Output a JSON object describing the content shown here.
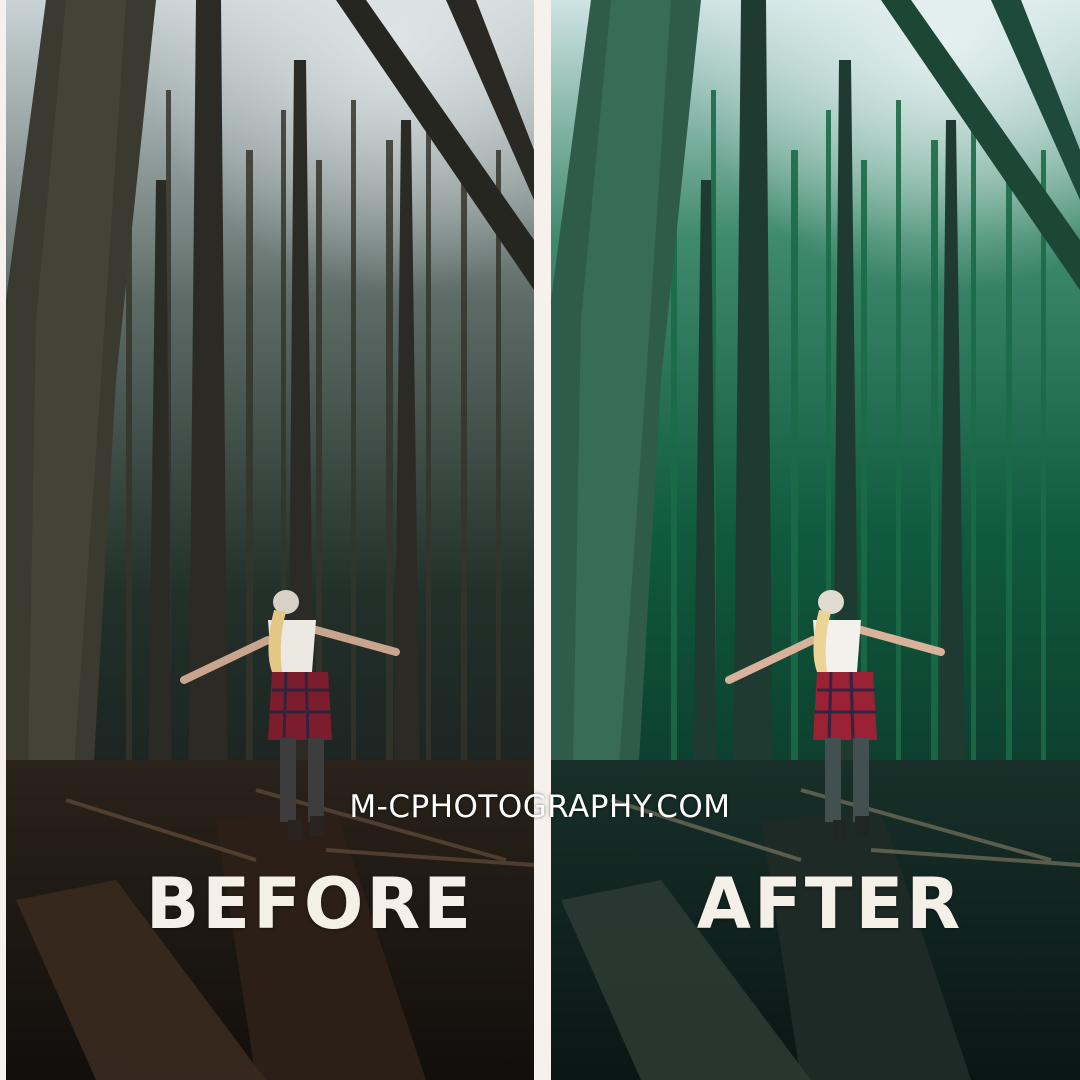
{
  "labels": {
    "before": "BEFORE",
    "after": "AFTER",
    "watermark": "M-CPHOTOGRAPHY.COM"
  },
  "colors": {
    "background": "#f6f1ec",
    "label_text": "#f4efe7",
    "before_sky": "#c9d3d6",
    "before_canopy": "#22302a",
    "before_trunk": "#2c2a24",
    "before_floor": "#1d1712",
    "after_sky": "#cfe3e4",
    "after_canopy": "#0f5a3c",
    "after_trunk": "#1f3b31",
    "after_floor": "#0f1e1c"
  }
}
